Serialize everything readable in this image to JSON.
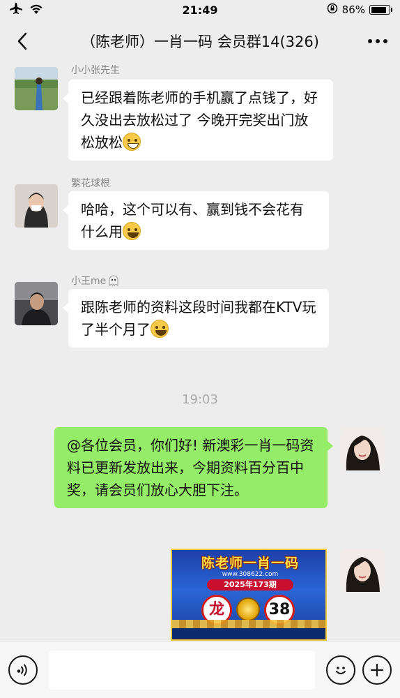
{
  "status_bar": {
    "time": "21:49",
    "battery_percent": "86%",
    "battery_level": 0.86
  },
  "header": {
    "title": "（陈老师）一肖一码 会员群14(326)",
    "back_icon": "chevron-left-icon",
    "more_icon": "more-dots-icon"
  },
  "messages": [
    {
      "sender": "小小张先生",
      "text_parts": [
        "已经跟着陈老师的手机赢了点钱了，好久没出去放松过了 今晚开完奖出门放松放松"
      ],
      "emoji": "grinning-emoji"
    },
    {
      "sender": "繁花球根",
      "text_parts": [
        "哈哈，这个可以有、赢到钱不会花有什么用"
      ],
      "emoji": "tears-of-joy-emoji"
    },
    {
      "sender": "小王me",
      "text_parts": [
        "跟陈老师的资料这段时间我都在KTV玩了半个月了"
      ],
      "emoji": "tears-of-joy-emoji"
    }
  ],
  "timestamp": "19:03",
  "own_message": {
    "text": "@各位会员，你们好! 新澳彩一肖一码资料已更新发放出来，今期资料百分百中奖，请会员们放心大胆下注。"
  },
  "poster": {
    "title": "陈老师一肖一码",
    "url": "www.308622.com",
    "issue": "2025年173期",
    "zodiac": "龙",
    "number": "38"
  },
  "input_bar": {
    "voice_icon": "voice-icon",
    "emoji_icon": "smiley-icon",
    "plus_icon": "plus-icon"
  }
}
